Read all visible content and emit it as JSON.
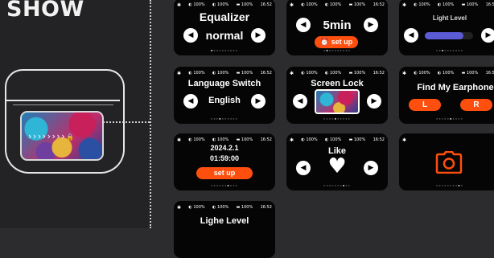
{
  "page": {
    "title": "SHOW"
  },
  "case": {
    "arrows": "› › › › › › › ›",
    "lock": "🔒"
  },
  "status": {
    "bt": "✱",
    "left": "◐ 100%",
    "right": "◐ 100%",
    "case": "▬ 100%",
    "time": "16:52"
  },
  "dots": {
    "off": "●",
    "on": "●"
  },
  "nav": {
    "left": "◀",
    "right": "▶"
  },
  "cards": {
    "equalizer": {
      "title": "Equalizer",
      "value": "normal"
    },
    "timer": {
      "value": "5min",
      "button": "⏰ set up"
    },
    "light": {
      "title": "Light Level",
      "bar_color": "#5b5bd6",
      "level": 0.8
    },
    "language": {
      "title": "Language Switch",
      "value": "English"
    },
    "screenlock": {
      "title": "Screen Lock"
    },
    "find": {
      "title": "Find My Earphone",
      "left": "L",
      "right": "R"
    },
    "datetime": {
      "date": "2024.2.1",
      "time": "01:59:00",
      "button": "set up"
    },
    "like": {
      "title": "Like",
      "icon": "♥"
    },
    "camera": {
      "icon": "camera-icon",
      "color": "#ff4f0e"
    },
    "lighe": {
      "title": "Lighe Level"
    }
  }
}
